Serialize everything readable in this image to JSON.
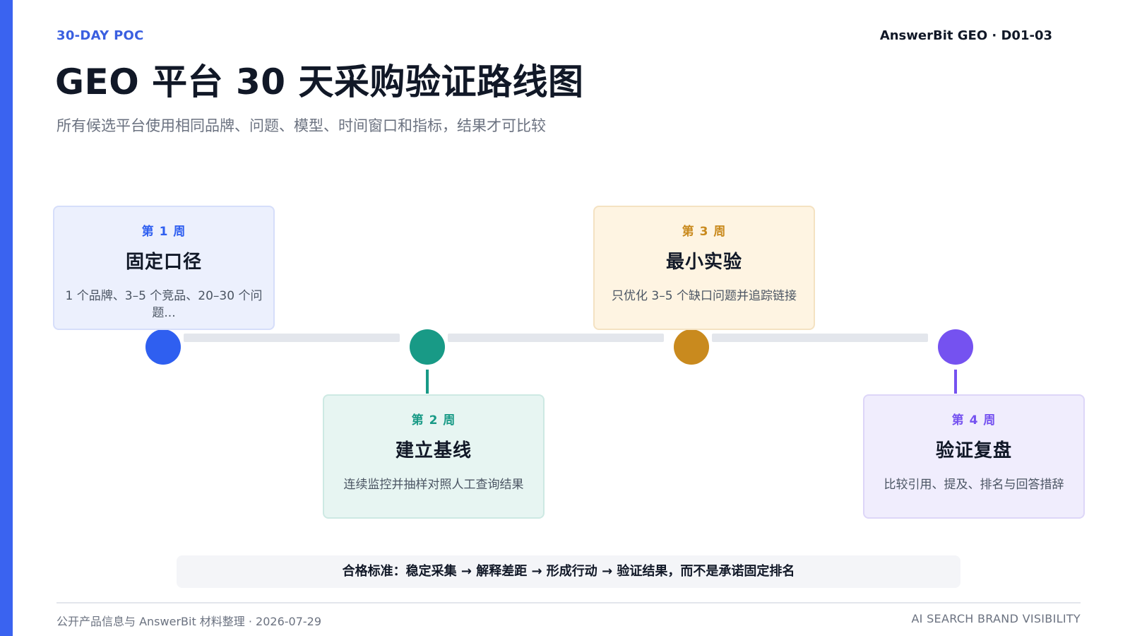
{
  "header": {
    "eyebrow": "30-DAY POC",
    "doc_id": "AnswerBit GEO · D01-03",
    "title": "GEO 平台 30 天采购验证路线图",
    "subtitle": "所有候选平台使用相同品牌、问题、模型、时间窗口和指标，结果才可比较"
  },
  "colors": {
    "accent": "#3a63f0",
    "week1": "#2f5ff0",
    "week2": "#189a86",
    "week3": "#c98a1e",
    "week4": "#7552f0"
  },
  "timeline": [
    {
      "week": "第 1 周",
      "name": "固定口径",
      "desc": "1 个品牌、3–5 个竞品、20–30 个问题..."
    },
    {
      "week": "第 2 周",
      "name": "建立基线",
      "desc": "连续监控并抽样对照人工查询结果"
    },
    {
      "week": "第 3 周",
      "name": "最小实验",
      "desc": "只优化 3–5 个缺口问题并追踪链接"
    },
    {
      "week": "第 4 周",
      "name": "验证复盘",
      "desc": "比较引用、提及、排名与回答措辞"
    }
  ],
  "criteria": "合格标准：稳定采集 → 解释差距 → 形成行动 → 验证结果，而不是承诺固定排名",
  "footer": {
    "source": "公开产品信息与 AnswerBit 材料整理 · 2026-07-29",
    "tagline": "AI SEARCH BRAND VISIBILITY"
  }
}
